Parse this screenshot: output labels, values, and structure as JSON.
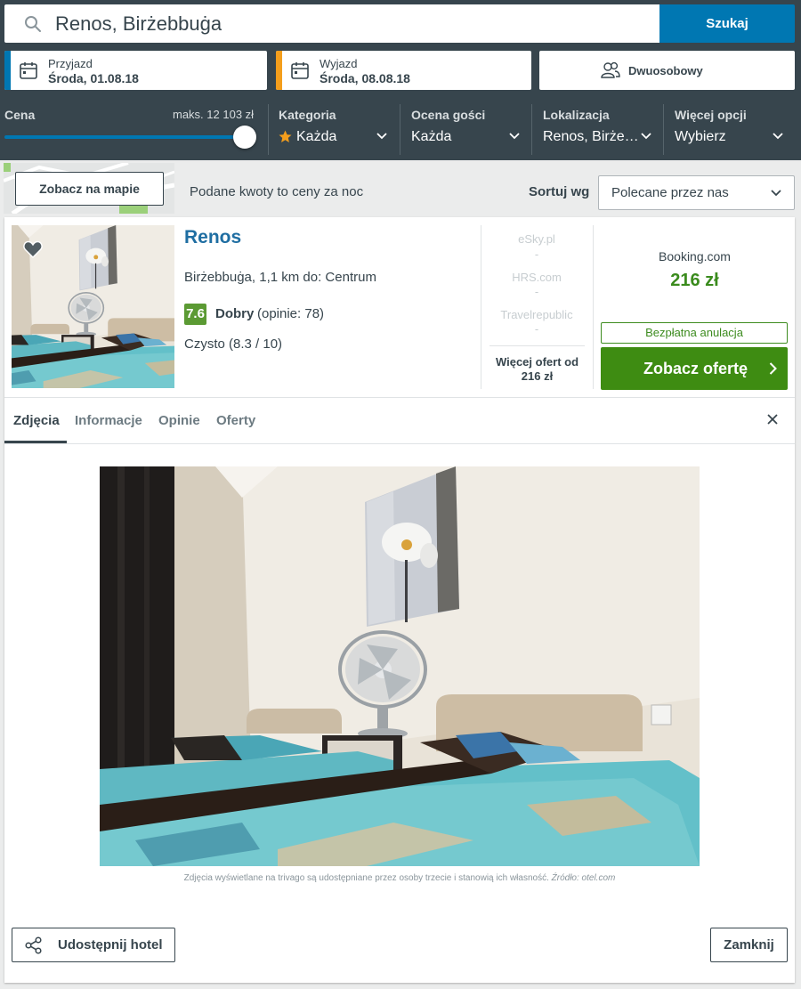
{
  "search": {
    "query": "Renos, Birżebbuġa",
    "button_label": "Szukaj"
  },
  "dates": {
    "checkin_label": "Przyjazd",
    "checkin_value": "Środa, 01.08.18",
    "checkout_label": "Wyjazd",
    "checkout_value": "Środa, 08.08.18"
  },
  "room": {
    "label": "Dwuosobowy"
  },
  "filters": {
    "price_title": "Cena",
    "price_max": "maks. 12 103 zł",
    "price_slider_fraction": 1.0,
    "category_title": "Kategoria",
    "category_value": "Każda",
    "rating_title": "Ocena gości",
    "rating_value": "Każda",
    "location_title": "Lokalizacja",
    "location_value": "Renos, Birże…",
    "more_title": "Więcej opcji",
    "more_value": "Wybierz"
  },
  "toolbar": {
    "map_button": "Zobacz na mapie",
    "price_note": "Podane kwoty to ceny za noc",
    "sort_label": "Sortuj wg",
    "sort_value": "Polecane przez nas"
  },
  "hotel": {
    "name": "Renos",
    "location": "Birżebbuġa, 1,1 km do: Centrum",
    "rating_score": "7.6",
    "rating_word": "Dobry",
    "rating_count": "(opinie: 78)",
    "cleanliness": "Czysto (8.3 / 10)",
    "other_partners": [
      {
        "name": "eSky.pl",
        "price": "-"
      },
      {
        "name": "HRS.com",
        "price": "-"
      },
      {
        "name": "Travelrepublic",
        "price": "-"
      }
    ],
    "more_offers": "Więcej ofert od 216 zł",
    "best_partner": "Booking.com",
    "best_price": "216 zł",
    "free_cancel": "Bezpłatna anulacja",
    "deal_button": "Zobacz ofertę"
  },
  "tabs": [
    {
      "label": "Zdjęcia",
      "active": true
    },
    {
      "label": "Informacje",
      "active": false
    },
    {
      "label": "Opinie",
      "active": false
    },
    {
      "label": "Oferty",
      "active": false
    }
  ],
  "photo": {
    "credit_text": "Zdjęcia wyświetlane na trivago są udostępniane przez osoby trzecie i stanowią ich własność.",
    "credit_source": "Źródło: otel.com"
  },
  "footer": {
    "share_button": "Udostępnij hotel",
    "close_button": "Zamknij"
  },
  "colors": {
    "dark_header": "#37454d",
    "accent_blue": "#0077b2",
    "checkin_stripe": "#0077b2",
    "checkout_stripe": "#f49e1c",
    "rating_green": "#5b9a33",
    "deal_green": "#3e8c12",
    "hotel_name_blue": "#1f6ea2",
    "star_orange": "#f49e1c"
  }
}
